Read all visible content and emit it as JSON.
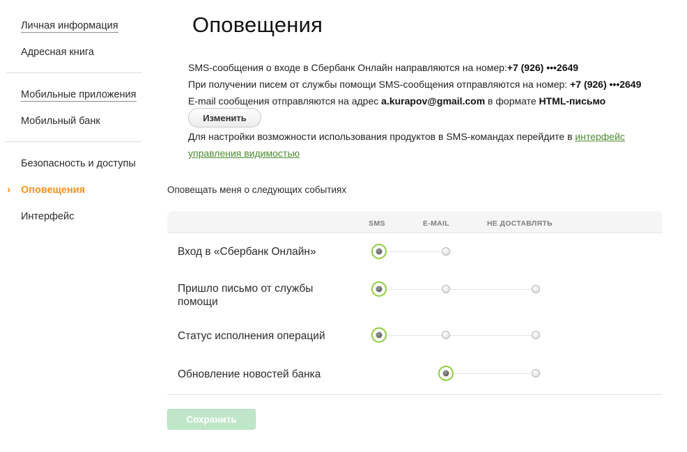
{
  "sidebar": {
    "items": [
      {
        "label": "Личная информация"
      },
      {
        "label": "Адресная книга"
      },
      {
        "label": "Мобильные приложения"
      },
      {
        "label": "Мобильный банк"
      },
      {
        "label": "Безопасность и доступы"
      },
      {
        "label": "Оповещения",
        "active": true
      },
      {
        "label": "Интерфейс"
      }
    ],
    "active_indicator": "chevron-right-icon"
  },
  "page": {
    "title": "Оповещения"
  },
  "info": {
    "sms_prefix": "SMS-сообщения о входе в Сбербанк Онлайн направляются на номер:",
    "sms_number": "+7 (926) •••2649",
    "help_prefix": "При получении писем от службы помощи SMS-сообщения отправляются на номер: ",
    "help_number": "+7 (926) •••2649",
    "email_prefix": "E-mail сообщения отправляются на адрес ",
    "email_address": "a.kurapov@gmail.com",
    "email_middle": " в формате ",
    "email_format": "HTML-письмо",
    "change_label": "Изменить",
    "sms_cmd_prefix": "Для настройки возможности использования продуктов в SMS-командах перейдите в ",
    "sms_cmd_link1": "интерфейс",
    "sms_cmd_link2": "управления видимостью"
  },
  "notifications": {
    "section_label": "Оповещать меня о следующих событиях",
    "columns": {
      "sms": "SMS",
      "email": "E-MAIL",
      "none": "НЕ ДОСТАВЛЯТЬ"
    },
    "rows": [
      {
        "label": "Вход в «Сбербанк Онлайн»",
        "options": [
          "sms",
          "email"
        ],
        "selected": "sms"
      },
      {
        "label_line1": "Пришло письмо от службы",
        "label_line2": "помощи",
        "options": [
          "sms",
          "email",
          "none"
        ],
        "selected": "sms"
      },
      {
        "label": "Статус исполнения операций",
        "options": [
          "sms",
          "email",
          "none"
        ],
        "selected": "sms"
      },
      {
        "label": "Обновление новостей банка",
        "options": [
          "email",
          "none"
        ],
        "selected": "email"
      }
    ]
  },
  "save_label": "Сохранить",
  "colors": {
    "accent_orange": "#f39224",
    "radio_selected_ring": "#8dcb3f",
    "link_green": "#4b8b2f",
    "save_disabled": "#bfe6c8"
  }
}
